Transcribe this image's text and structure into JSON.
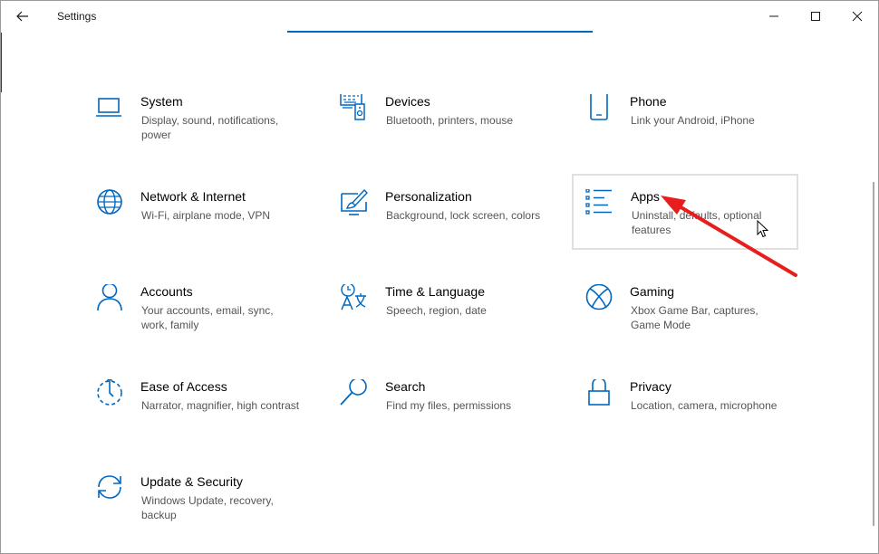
{
  "window": {
    "title": "Settings"
  },
  "icons": {
    "back": "back-arrow-icon",
    "minimize": "minimize-icon",
    "maximize": "maximize-icon",
    "close": "close-icon"
  },
  "colors": {
    "accent": "#0067c0",
    "annotation": "#e81e1e"
  },
  "tiles": [
    {
      "id": "system",
      "title": "System",
      "desc": "Display, sound, notifications, power",
      "icon": "laptop-icon"
    },
    {
      "id": "devices",
      "title": "Devices",
      "desc": "Bluetooth, printers, mouse",
      "icon": "devices-icon"
    },
    {
      "id": "phone",
      "title": "Phone",
      "desc": "Link your Android, iPhone",
      "icon": "phone-icon"
    },
    {
      "id": "network",
      "title": "Network & Internet",
      "desc": "Wi-Fi, airplane mode, VPN",
      "icon": "globe-icon"
    },
    {
      "id": "personalization",
      "title": "Personalization",
      "desc": "Background, lock screen, colors",
      "icon": "paint-brush-icon"
    },
    {
      "id": "apps",
      "title": "Apps",
      "desc": "Uninstall, defaults, optional features",
      "icon": "apps-list-icon"
    },
    {
      "id": "accounts",
      "title": "Accounts",
      "desc": "Your accounts, email, sync, work, family",
      "icon": "person-icon"
    },
    {
      "id": "time",
      "title": "Time & Language",
      "desc": "Speech, region, date",
      "icon": "language-icon"
    },
    {
      "id": "gaming",
      "title": "Gaming",
      "desc": "Xbox Game Bar, captures, Game Mode",
      "icon": "xbox-icon"
    },
    {
      "id": "ease",
      "title": "Ease of Access",
      "desc": "Narrator, magnifier, high contrast",
      "icon": "ease-of-access-icon"
    },
    {
      "id": "search",
      "title": "Search",
      "desc": "Find my files, permissions",
      "icon": "search-icon"
    },
    {
      "id": "privacy",
      "title": "Privacy",
      "desc": "Location, camera, microphone",
      "icon": "lock-icon"
    },
    {
      "id": "update",
      "title": "Update & Security",
      "desc": "Windows Update, recovery, backup",
      "icon": "sync-icon"
    }
  ]
}
